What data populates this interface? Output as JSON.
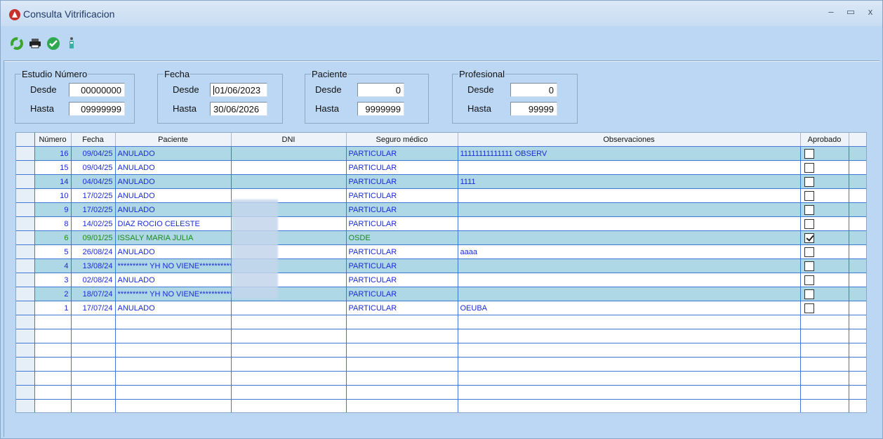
{
  "window": {
    "title": "Consulta Vitrificacion"
  },
  "filters": {
    "estudio": {
      "legend": "Estudio Número",
      "desde_label": "Desde",
      "hasta_label": "Hasta",
      "desde": "00000000",
      "hasta": "09999999"
    },
    "fecha": {
      "legend": "Fecha",
      "desde_label": "Desde",
      "hasta_label": "Hasta",
      "desde": "01/06/2023",
      "hasta": "30/06/2026"
    },
    "paciente": {
      "legend": "Paciente",
      "desde_label": "Desde",
      "hasta_label": "Hasta",
      "desde": "0",
      "hasta": "9999999"
    },
    "profesional": {
      "legend": "Profesional",
      "desde_label": "Desde",
      "hasta_label": "Hasta",
      "desde": "0",
      "hasta": "99999"
    }
  },
  "table": {
    "headers": {
      "numero": "Número",
      "fecha": "Fecha",
      "paciente": "Paciente",
      "dni": "DNI",
      "seguro": "Seguro médico",
      "observaciones": "Observaciones",
      "aprobado": "Aprobado"
    },
    "rows": [
      {
        "numero": "16",
        "fecha": "09/04/25",
        "paciente": "ANULADO",
        "dni": "",
        "seguro": "PARTICULAR",
        "obs": "11111111111111 OBSERV",
        "aprobado": false
      },
      {
        "numero": "15",
        "fecha": "09/04/25",
        "paciente": "ANULADO",
        "dni": "",
        "seguro": "PARTICULAR",
        "obs": "",
        "aprobado": false
      },
      {
        "numero": "14",
        "fecha": "04/04/25",
        "paciente": "ANULADO",
        "dni": "",
        "seguro": "PARTICULAR",
        "obs": "1111",
        "aprobado": false
      },
      {
        "numero": "10",
        "fecha": "17/02/25",
        "paciente": "ANULADO",
        "dni": "",
        "seguro": "PARTICULAR",
        "obs": "",
        "aprobado": false
      },
      {
        "numero": "9",
        "fecha": "17/02/25",
        "paciente": "ANULADO",
        "dni": "",
        "seguro": "PARTICULAR",
        "obs": "",
        "aprobado": false
      },
      {
        "numero": "8",
        "fecha": "14/02/25",
        "paciente": "DIAZ ROCIO CELESTE",
        "dni": "",
        "seguro": "PARTICULAR",
        "obs": "",
        "aprobado": false
      },
      {
        "numero": "6",
        "fecha": "09/01/25",
        "paciente": "ISSALY MARIA JULIA",
        "dni": "",
        "seguro": "OSDE",
        "obs": "",
        "aprobado": true
      },
      {
        "numero": "5",
        "fecha": "26/08/24",
        "paciente": "ANULADO",
        "dni": "",
        "seguro": "PARTICULAR",
        "obs": "aaaa",
        "aprobado": false
      },
      {
        "numero": "4",
        "fecha": "13/08/24",
        "paciente": "********** YH NO VIENE************",
        "dni": "",
        "seguro": "PARTICULAR",
        "obs": "",
        "aprobado": false
      },
      {
        "numero": "3",
        "fecha": "02/08/24",
        "paciente": "ANULADO",
        "dni": "",
        "seguro": "PARTICULAR",
        "obs": "",
        "aprobado": false
      },
      {
        "numero": "2",
        "fecha": "18/07/24",
        "paciente": "********** YH NO VIENE************",
        "dni": "",
        "seguro": "PARTICULAR",
        "obs": "",
        "aprobado": false
      },
      {
        "numero": "1",
        "fecha": "17/07/24",
        "paciente": "ANULADO",
        "dni": "",
        "seguro": "PARTICULAR",
        "obs": "OEUBA",
        "aprobado": false
      }
    ],
    "empty_rows": 7
  },
  "toolbar": {
    "icons": [
      "refresh-icon",
      "print-icon",
      "accept-icon",
      "exit-icon"
    ]
  },
  "colors": {
    "row_alt": "#aed8e6",
    "text_blue": "#1a2bd6",
    "text_green": "#1b8a1b"
  }
}
